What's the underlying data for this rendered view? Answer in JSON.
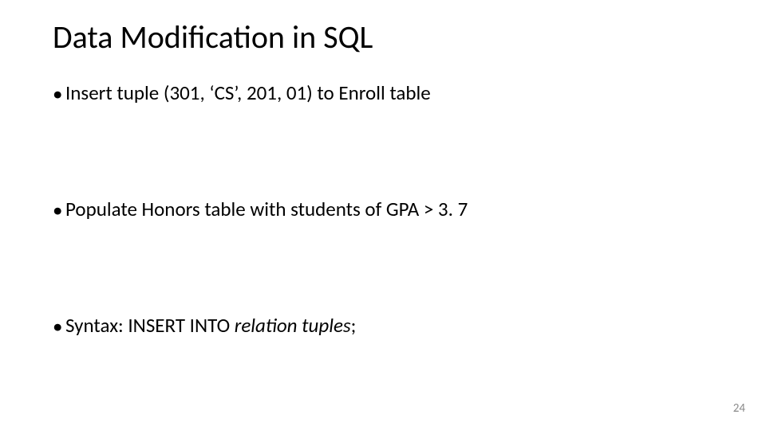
{
  "title": "Data Modification in SQL",
  "marker": "•",
  "bullets": [
    "Insert tuple (301, ‘CS’, 201, 01) to Enroll table",
    "Populate Honors table with students of GPA > 3. 7",
    ""
  ],
  "syntax": {
    "prefix": "Syntax: INSERT INTO",
    "relation": "relation",
    "tuples": "tuples",
    "terminator": ";"
  },
  "page_number": "24"
}
